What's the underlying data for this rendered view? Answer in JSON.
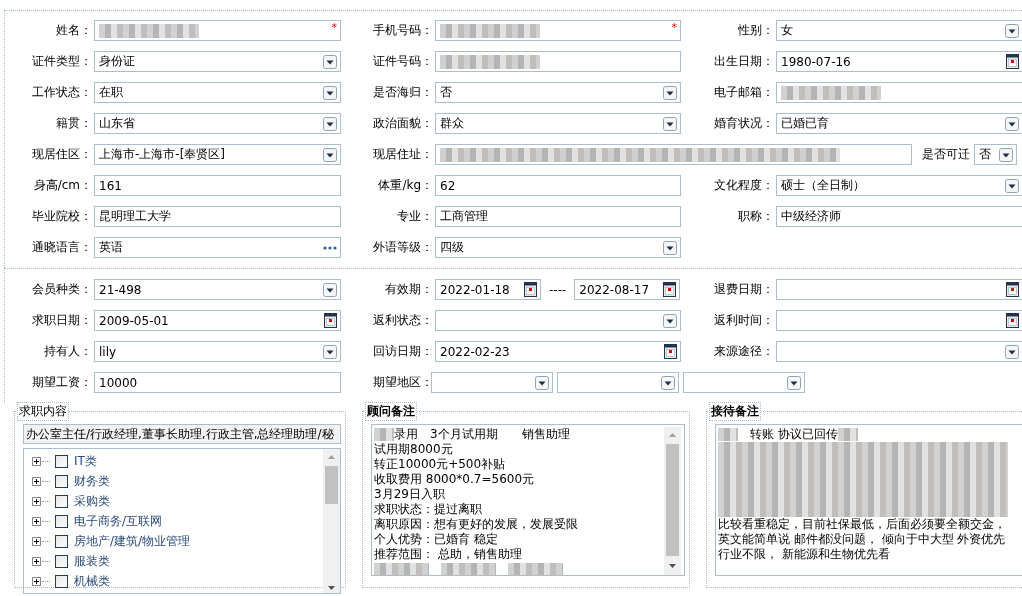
{
  "sections": [
    {
      "rows": [
        [
          {
            "label": "姓名：",
            "kind": "text",
            "redacted": true,
            "required_mark": "*"
          },
          {
            "label": "手机号码：",
            "kind": "text",
            "redacted": true,
            "required_mark": "*"
          },
          {
            "label": "性别：",
            "kind": "select",
            "value": "女"
          }
        ],
        [
          {
            "label": "证件类型：",
            "kind": "select",
            "value": "身份证"
          },
          {
            "label": "证件号码：",
            "kind": "text",
            "redacted": true
          },
          {
            "label": "出生日期：",
            "kind": "date",
            "value": "1980-07-16"
          }
        ],
        [
          {
            "label": "工作状态：",
            "kind": "select",
            "value": "在职"
          },
          {
            "label": "是否海归：",
            "kind": "select",
            "value": "否"
          },
          {
            "label": "电子邮箱：",
            "kind": "text",
            "redacted": true
          }
        ],
        [
          {
            "label": "籍贯：",
            "kind": "select",
            "value": "山东省"
          },
          {
            "label": "政治面貌：",
            "kind": "select",
            "value": "群众"
          },
          {
            "label": "婚育状况：",
            "kind": "select",
            "value": "已婚已育"
          }
        ],
        [
          {
            "label": "现居住区：",
            "kind": "select",
            "value": "上海市-上海市-[奉贤区]"
          },
          {
            "label": "现居住址：",
            "kind": "text",
            "redacted": true,
            "attached": {
              "label": "是否可迁",
              "kind": "select",
              "value": "否"
            }
          }
        ],
        [
          {
            "label": "身高/cm：",
            "kind": "text",
            "value": "161"
          },
          {
            "label": "体重/kg：",
            "kind": "text",
            "value": "62"
          },
          {
            "label": "文化程度：",
            "kind": "select",
            "value": "硕士（全日制）"
          }
        ],
        [
          {
            "label": "毕业院校：",
            "kind": "text",
            "value": "昆明理工大学"
          },
          {
            "label": "专业：",
            "kind": "text",
            "value": "工商管理"
          },
          {
            "label": "职称：",
            "kind": "text",
            "value": "中级经济师"
          }
        ],
        [
          {
            "label": "通晓语言：",
            "kind": "more",
            "value": "英语"
          },
          {
            "label": "外语等级：",
            "kind": "select",
            "value": "四级"
          }
        ]
      ]
    },
    {
      "rows": [
        [
          {
            "label": "会员种类：",
            "kind": "select",
            "value": "21-498"
          },
          {
            "label": "有效期：",
            "kind": "range",
            "values": [
              "2022-01-18",
              "2022-08-17"
            ],
            "separator": "----"
          },
          {
            "label": "退费日期：",
            "kind": "date"
          }
        ],
        [
          {
            "label": "求职日期：",
            "kind": "date",
            "value": "2009-05-01"
          },
          {
            "label": "返利状态：",
            "kind": "select"
          },
          {
            "label": "返利时间：",
            "kind": "date"
          }
        ],
        [
          {
            "label": "持有人：",
            "kind": "select",
            "value": "lily"
          },
          {
            "label": "回访日期：",
            "kind": "date",
            "value": "2022-02-23"
          },
          {
            "label": "来源途径：",
            "kind": "select"
          }
        ],
        [
          {
            "label": "期望工资：",
            "kind": "text",
            "value": "10000"
          },
          {
            "label": "期望地区：",
            "kind": "multi",
            "selects": [
              {
                "kind": "select"
              },
              {
                "kind": "select"
              },
              {
                "kind": "select"
              }
            ]
          }
        ]
      ]
    }
  ],
  "job_panel": {
    "legend": "求职内容",
    "summary": "办公室主任/行政经理,董事长助理,行政主管,总经理助理/秘",
    "tree": [
      {
        "label": "IT类",
        "checked": false,
        "expanded": false
      },
      {
        "label": "财务类",
        "checked": false,
        "expanded": false
      },
      {
        "label": "采购类",
        "checked": false,
        "expanded": false
      },
      {
        "label": "电子商务/互联网",
        "checked": false,
        "expanded": false
      },
      {
        "label": "房地产/建筑/物业管理",
        "checked": false,
        "expanded": false
      },
      {
        "label": "服装类",
        "checked": false,
        "expanded": false
      },
      {
        "label": "机械类",
        "checked": false,
        "expanded": false
      }
    ]
  },
  "notes": [
    {
      "legend": "顾问备注",
      "bold": true,
      "scrollbar": true,
      "lines": [
        [
          {
            "kind": "redacted"
          },
          {
            "kind": "text",
            "text": "录用　3个月试用期　　销售助理"
          }
        ],
        [
          {
            "kind": "text",
            "text": "试用期8000元"
          }
        ],
        [
          {
            "kind": "text",
            "text": "转正10000元+500补贴"
          }
        ],
        [
          {
            "kind": "text",
            "text": "收取费用 8000*0.7=5600元"
          }
        ],
        [
          {
            "kind": "text",
            "text": "3月29日入职"
          }
        ],
        [
          {
            "kind": "text",
            "text": "求职状态：提过离职"
          }
        ],
        [
          {
            "kind": "text",
            "text": "离职原因：想有更好的发展，发展受限"
          }
        ],
        [
          {
            "kind": "text",
            "text": "个人优势：已婚育 稳定"
          }
        ],
        [
          {
            "kind": "text",
            "text": "推荐范围： 总助，销售助理"
          }
        ],
        [
          {
            "kind": "redacted"
          },
          {
            "kind": "redacted"
          },
          {
            "kind": "redacted"
          }
        ]
      ]
    },
    {
      "legend": "接待备注",
      "bold": true,
      "scrollbar": false,
      "lines": [
        [
          {
            "kind": "redacted"
          },
          {
            "kind": "text",
            "text": "　转账 协议已回传"
          },
          {
            "kind": "redacted"
          }
        ],
        [
          {
            "kind": "redacted"
          }
        ],
        [
          {
            "kind": "redacted"
          }
        ],
        [
          {
            "kind": "redacted"
          }
        ],
        [
          {
            "kind": "redacted"
          }
        ],
        [
          {
            "kind": "redacted"
          }
        ],
        [
          {
            "kind": "text",
            "text": "比较看重稳定，目前社保最低，后面必须要全额交金，"
          }
        ],
        [
          {
            "kind": "text",
            "text": "英文能简单说 邮件都没问题， 倾向于中大型 外资优先"
          }
        ],
        [
          {
            "kind": "text",
            "text": "行业不限， 新能源和生物优先看"
          }
        ]
      ]
    }
  ]
}
